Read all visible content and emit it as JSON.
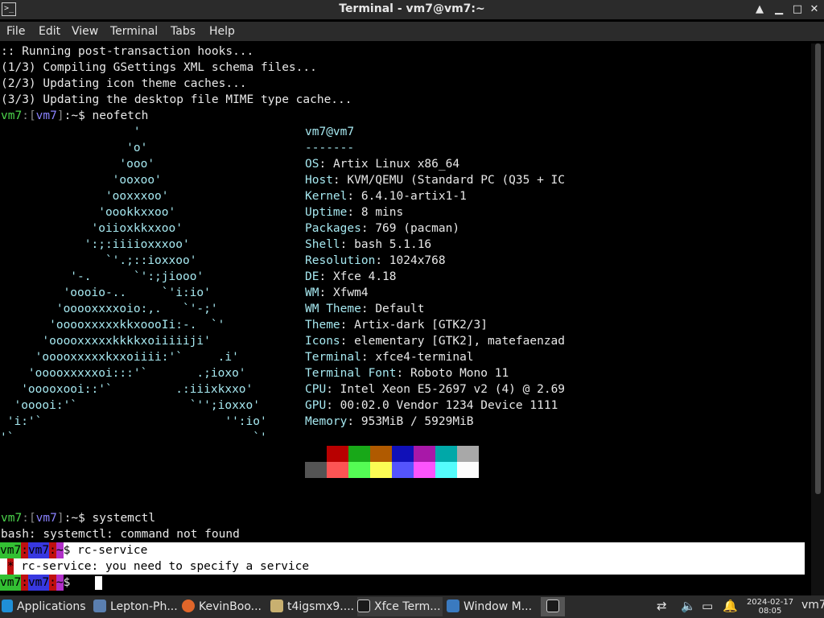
{
  "window": {
    "title": "Terminal - vm7@vm7:~",
    "icon": "terminal-icon",
    "minimize_glyph": "▲",
    "maximize_glyph": "□",
    "close_glyph": "✕"
  },
  "menu": [
    "File",
    "Edit",
    "View",
    "Terminal",
    "Tabs",
    "Help"
  ],
  "terminal": {
    "output_top": [
      ":: Running post-transaction hooks...",
      "(1/3) Compiling GSettings XML schema files...",
      "(2/3) Updating icon theme caches...",
      "(3/3) Updating the desktop file MIME type cache..."
    ],
    "prompt": {
      "user": "vm7",
      "colon": ":",
      "host": "vm7",
      "suffix": ":~$ "
    },
    "cmd1": "neofetch",
    "logo": [
      "                   '",
      "                  'o'",
      "                 'ooo'",
      "                'ooxoo'",
      "               'ooxxxoo'",
      "              'oookkxxoo'",
      "             'oiioxkkxxoo'",
      "            ':;:iiiioxxxoo'",
      "               `'.;::ioxxoo'",
      "          '-.      `':;jiooo'",
      "         'oooio-..     `'i:io'",
      "        'ooooxxxxoio:,.   `'-;'",
      "       'ooooxxxxxkkxoooIi:-.  `'",
      "      'ooooxxxxxkkkkxoiiiiiji'",
      "     'ooooxxxxxkxxoiiii:'`     .i'",
      "    'ooooxxxxxoi:::'`       .;ioxo'",
      "   'ooooxooi::'`         .:iiixkxxo'",
      "  'ooooi:'`                `'';ioxxo'",
      " 'i:'`                          '':io'",
      "'`                                  `'"
    ],
    "header": "vm7@vm7",
    "separator": "-------",
    "info": [
      {
        "key": "OS",
        "value": "Artix Linux x86_64"
      },
      {
        "key": "Host",
        "value": "KVM/QEMU (Standard PC (Q35 + IC"
      },
      {
        "key": "Kernel",
        "value": "6.4.10-artix1-1"
      },
      {
        "key": "Uptime",
        "value": "8 mins"
      },
      {
        "key": "Packages",
        "value": "769 (pacman)"
      },
      {
        "key": "Shell",
        "value": "bash 5.1.16"
      },
      {
        "key": "Resolution",
        "value": "1024x768"
      },
      {
        "key": "DE",
        "value": "Xfce 4.18"
      },
      {
        "key": "WM",
        "value": "Xfwm4"
      },
      {
        "key": "WM Theme",
        "value": "Default"
      },
      {
        "key": "Theme",
        "value": "Artix-dark [GTK2/3]"
      },
      {
        "key": "Icons",
        "value": "elementary [GTK2], matefaenzad"
      },
      {
        "key": "Terminal",
        "value": "xfce4-terminal"
      },
      {
        "key": "Terminal Font",
        "value": "Roboto Mono 11"
      },
      {
        "key": "CPU",
        "value": "Intel Xeon E5-2697 v2 (4) @ 2.69"
      },
      {
        "key": "GPU",
        "value": "00:02.0 Vendor 1234 Device 1111"
      },
      {
        "key": "Memory",
        "value": "953MiB / 5929MiB"
      }
    ],
    "info_sep": ": ",
    "palette_row1": [
      "#000000",
      "#b80000",
      "#18a818",
      "#b05a00",
      "#1010b8",
      "#a818a8",
      "#00a8a8",
      "#a8a8a8"
    ],
    "palette_row2": [
      "#545454",
      "#fc5454",
      "#54fc54",
      "#fcfc54",
      "#5454fc",
      "#fc54fc",
      "#54fcfc",
      "#fcfcfc"
    ],
    "cmd2": "systemctl",
    "err1": "bash: systemctl: command not found",
    "cmd3": "rc-service",
    "err2_star": "*",
    "err2": " rc-service: you need to specify a service"
  },
  "taskbar": {
    "applications": "Applications",
    "tasks": [
      {
        "label": "Lepton-Ph...",
        "icon": "window-icon",
        "color": "#5a7fb0"
      },
      {
        "label": "KevinBoo...",
        "icon": "firefox-icon",
        "color": "#e0662a"
      },
      {
        "label": "t4igsmx9....",
        "icon": "folder-icon",
        "color": "#c8b070"
      },
      {
        "label": "Xfce Term...",
        "icon": "terminal-icon",
        "color": "#3a3a3a"
      },
      {
        "label": "Window M...",
        "icon": "window-manager-icon",
        "color": "#3a7ac0"
      }
    ],
    "clock_date": "2024-02-17",
    "clock_time": "08:05",
    "user": "vm7"
  }
}
